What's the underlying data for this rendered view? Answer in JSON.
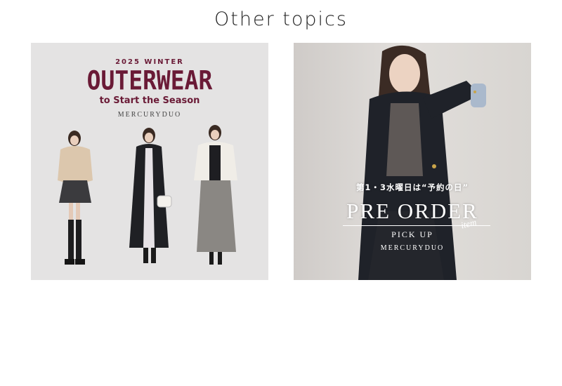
{
  "section": {
    "title": "Other topics"
  },
  "cards": [
    {
      "season": "2025 WINTER",
      "title": "OUTERWEAR",
      "subtitle": "to Start the Season",
      "brand": "MERCURYDUO"
    },
    {
      "subtitle": "第1・3水曜日は“予約の日”",
      "title": "PRE ORDER",
      "item": "item",
      "pick": "PICK UP",
      "brand": "MERCURYDUO"
    }
  ],
  "colors": {
    "accent": "#6a1a36",
    "text": "#222222",
    "card_bg_left": "#e4e3e3",
    "card_bg_right": "#d9d6d3"
  }
}
